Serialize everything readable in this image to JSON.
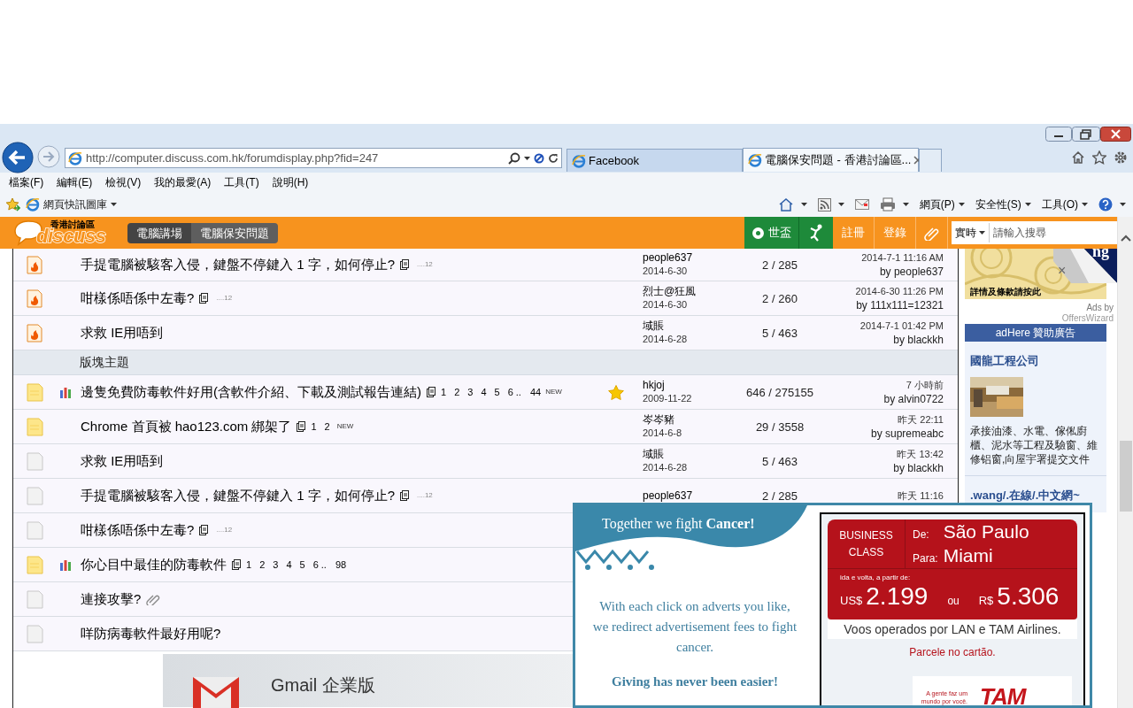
{
  "browser": {
    "address": "http://computer.discuss.com.hk/forumdisplay.php?fid=247",
    "tabs": [
      {
        "title": "Facebook",
        "selected": false
      },
      {
        "title": "電腦保安問題 - 香港討論區...",
        "selected": true
      }
    ],
    "menu": [
      "檔案(F)",
      "編輯(E)",
      "檢視(V)",
      "我的最愛(A)",
      "工具(T)",
      "說明(H)"
    ],
    "favorites_item": "網頁快訊圖庫",
    "commands": [
      "網頁(P)",
      "安全性(S)",
      "工具(O)"
    ]
  },
  "forum_header": {
    "logo_top": "香港討論區",
    "logo": "discuss",
    "breadcrumbs": [
      {
        "label": "電腦講場",
        "selected": false
      },
      {
        "label": "電腦保安問題",
        "selected": true
      }
    ],
    "world_cup": "世盃",
    "links": [
      "註冊",
      "登錄"
    ],
    "search": {
      "scope": "實時",
      "placeholder": "請輸入搜尋"
    }
  },
  "threads": [
    {
      "kind": "hot",
      "title": "手提電腦被駭客入侵，鍵盤不停鍵入 1 字，如何停止?",
      "mini": "....12",
      "author": "people637",
      "date": "2014-6-30",
      "counts": "2 / 285",
      "last_time": "2014-7-1 11:16 AM",
      "last_by": "by people637"
    },
    {
      "kind": "hot",
      "title": "咁樣係唔係中左毒?",
      "mini": "....12",
      "author": "烈士@狂風",
      "date": "2014-6-30",
      "counts": "2 / 260",
      "last_time": "2014-6-30 11:26 PM",
      "last_by": "by 111x111=12321"
    },
    {
      "kind": "hot",
      "title": "求救 IE用唔到",
      "author": "域賬",
      "date": "2014-6-28",
      "counts": "5 / 463",
      "last_time": "2014-7-1 01:42 PM",
      "last_by": "by blackkh"
    },
    {
      "kind": "section",
      "label": "版塊主題"
    },
    {
      "kind": "new",
      "poll": true,
      "title": "邊隻免費防毒軟件好用(含軟件介紹、下載及測試報告連結)",
      "pages": [
        "1",
        "2",
        "3",
        "4",
        "5",
        "6 .."
      ],
      "last_page": "44",
      "new_badge": "NEW",
      "starred": true,
      "author": "hkjoj",
      "date": "2009-11-22",
      "counts": "646 / 275155",
      "last_time": "7 小時前",
      "last_by": "by alvin0722"
    },
    {
      "kind": "new",
      "title": "Chrome 首頁被 hao123.com 綁架了",
      "pages": [
        "1",
        "2"
      ],
      "new_badge": "NEW",
      "author": "岑岑豬",
      "date": "2014-6-8",
      "counts": "29 / 3558",
      "last_time": "昨天 22:11",
      "last_by": "by supremeabc"
    },
    {
      "kind": "normal",
      "title": "求救 IE用唔到",
      "author": "域賬",
      "date": "2014-6-28",
      "counts": "5 / 463",
      "last_time": "昨天 13:42",
      "last_by": "by blackkh"
    },
    {
      "kind": "normal",
      "title": "手提電腦被駭客入侵，鍵盤不停鍵入 1 字，如何停止?",
      "mini": "....12",
      "author": "people637",
      "counts": "2 / 285",
      "last_time": "昨天 11:16"
    },
    {
      "kind": "normal",
      "title": "咁樣係唔係中左毒?",
      "mini": "....12"
    },
    {
      "kind": "new",
      "poll": true,
      "title": "你心目中最佳的防毒軟件",
      "pages": [
        "1",
        "2",
        "3",
        "4",
        "5",
        "6 .."
      ],
      "last_page": "98"
    },
    {
      "kind": "normal",
      "title": "連接攻擊?",
      "attachment": true
    },
    {
      "kind": "normal",
      "title": "咩防病毒軟件最好用呢?"
    }
  ],
  "gmail_banner": {
    "text": "Gmail 企業版"
  },
  "sidebar": {
    "ad_caption": "詳情及條款請按此",
    "ads_by": "Ads by",
    "ads_by_name": "OffersWizard",
    "header": "adHere 贊助廣告",
    "sponsors": [
      {
        "name": "國龍工程公司",
        "picture": true,
        "text": "承接油漆、水電、傢俬廚櫃、泥水等工程及驗窗、維修铝窗,向屋宇署提交文件"
      },
      {
        "name": ".wang/.在線/.中文網~"
      }
    ]
  },
  "corner_ad": {
    "text": "ng",
    "close": "×"
  },
  "popup": {
    "heading": "Together we fight **Cancer!**",
    "body": "With each click on adverts you like, we redirect advertisement fees to fight cancer.",
    "slogan": "Giving has never been easier!",
    "airline": {
      "class_label": "BUSINESS CLASS",
      "from_label": "De:",
      "from": "São Paulo",
      "to_label": "Para:",
      "to": "Miami",
      "note": "ida e volta, a partir de:",
      "usd_currency": "US$",
      "usd": "2.199",
      "or": "ou",
      "brl_currency": "R$",
      "brl": "5.306",
      "operated": "Voos operados por LAN e TAM Airlines.",
      "installments": "Parcele no cartão.",
      "tagline": "A gente faz um mundo por você.",
      "logo": "TAM"
    }
  }
}
